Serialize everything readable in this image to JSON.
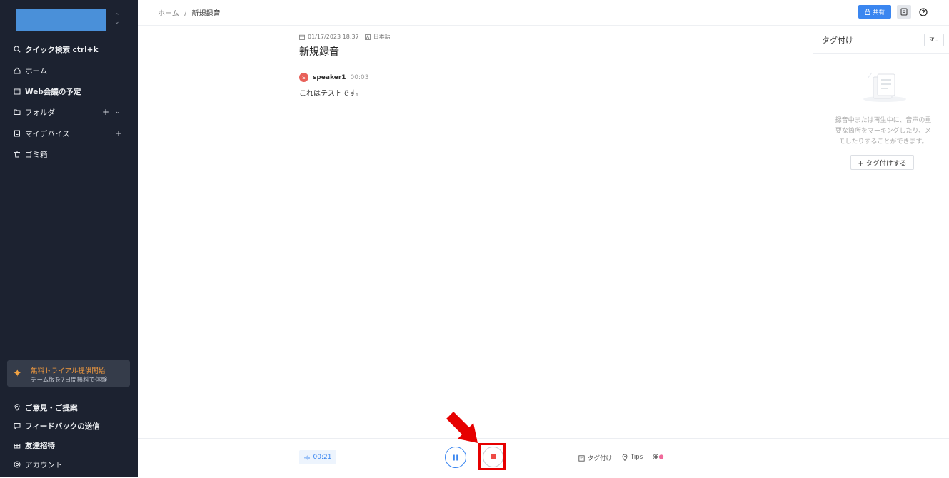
{
  "sidebar": {
    "quick_search": "クイック検索 ctrl+k",
    "home": "ホーム",
    "web_meeting": "Web会議の予定",
    "folder": "フォルダ",
    "my_device": "マイデバイス",
    "trash": "ゴミ箱",
    "trial_title": "無料トライアル提供開始",
    "trial_sub": "チーム版を7日間無料で体験",
    "feedback_suggest": "ご意見・ご提案",
    "feedback_send": "フィードバックの送信",
    "invite": "友達招待",
    "account": "アカウント",
    "workspace_color": "#4a90d9"
  },
  "header": {
    "breadcrumb_home": "ホーム",
    "breadcrumb_sep": "/",
    "breadcrumb_current": "新規録音",
    "share_label": "共有"
  },
  "recording": {
    "datetime": "01/17/2023 18:37",
    "language": "日本語",
    "title": "新規録音",
    "speaker_initial": "S",
    "speaker_name": "speaker1",
    "speaker_time": "00:03",
    "transcript": "これはテストです。"
  },
  "tags_panel": {
    "title": "タグ付け",
    "empty_line1": "録音中または再生中に、音声の重",
    "empty_line2": "要な箇所をマーキングしたり、メ",
    "empty_line3": "モしたりすることができます。",
    "add_label": "+ タグ付けする"
  },
  "player": {
    "elapsed": "00:21",
    "tag_label": "タグ付け",
    "tips_label": "Tips"
  },
  "colors": {
    "accent": "#3a86f0",
    "stop": "#ee4b45",
    "highlight": "#e60000"
  }
}
